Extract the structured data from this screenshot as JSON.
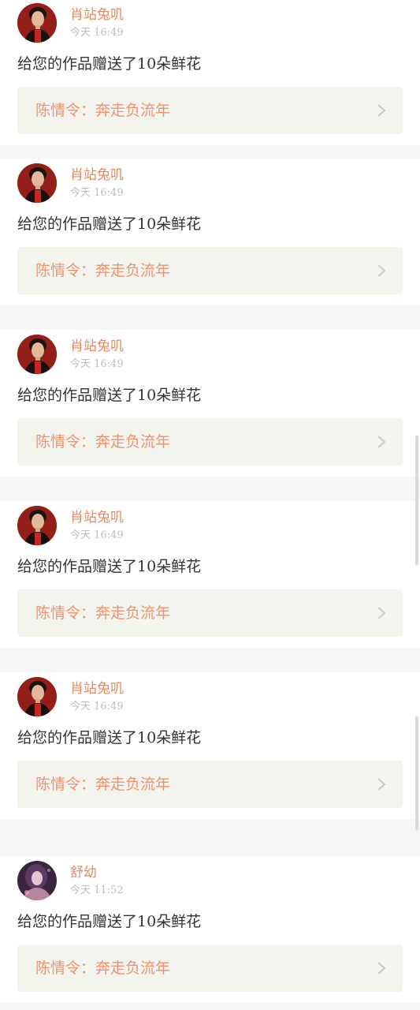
{
  "gift_messages": [
    {
      "user": "肖站兔叽",
      "avatar": "portrait-red-avatar",
      "time": "今天 16:49",
      "message": "给您的作品赠送了10朵鲜花",
      "work_title": "陈情令：奔走负流年",
      "chevron_icon": "chevron-right-icon"
    },
    {
      "user": "肖站兔叽",
      "avatar": "portrait-red-avatar",
      "time": "今天 16:49",
      "message": "给您的作品赠送了10朵鲜花",
      "work_title": "陈情令：奔走负流年",
      "chevron_icon": "chevron-right-icon"
    },
    {
      "user": "肖站兔叽",
      "avatar": "portrait-red-avatar",
      "time": "今天 16:49",
      "message": "给您的作品赠送了10朵鲜花",
      "work_title": "陈情令：奔走负流年",
      "chevron_icon": "chevron-right-icon"
    },
    {
      "user": "肖站兔叽",
      "avatar": "portrait-red-avatar",
      "time": "今天 16:49",
      "message": "给您的作品赠送了10朵鲜花",
      "work_title": "陈情令：奔走负流年",
      "chevron_icon": "chevron-right-icon"
    },
    {
      "user": "肖站兔叽",
      "avatar": "portrait-red-avatar",
      "time": "今天 16:49",
      "message": "给您的作品赠送了10朵鲜花",
      "work_title": "陈情令：奔走负流年",
      "chevron_icon": "chevron-right-icon"
    },
    {
      "user": "舒幼",
      "avatar": "portrait-purple-avatar",
      "time": "今天 11:52",
      "message": "给您的作品赠送了10朵鲜花",
      "work_title": "陈情令：奔走负流年",
      "chevron_icon": "chevron-right-icon"
    }
  ],
  "colors": {
    "username": "#e58a5e",
    "work_title": "#ef9270",
    "card_background": "#ffffff",
    "link_background": "#f4f4ee",
    "page_background": "#f6f6f6",
    "time_text": "#bdbdbd",
    "message_text": "#333333"
  }
}
